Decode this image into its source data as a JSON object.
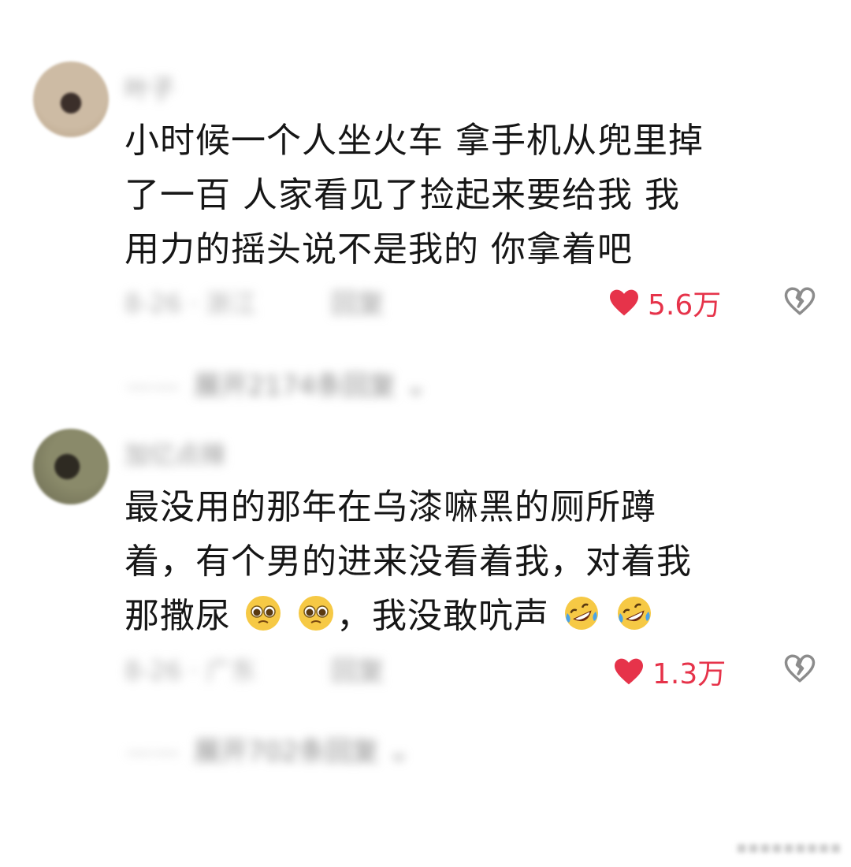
{
  "comments": [
    {
      "username": "叶子",
      "lines": [
        "小时候一个人坐火车  拿手机从兜里掉",
        "了一百 人家看见了捡起来要给我  我",
        "用力的摇头说不是我的 你拿着吧"
      ],
      "meta": "8-26 · 浙江",
      "reply_label": "回复",
      "likes": "5.6万",
      "expand_label": "展开2174条回复"
    },
    {
      "username": "加亿点辣",
      "lines": [
        "最没用的那年在乌漆嘛黑的厕所蹲",
        "着，有个男的进来没看着我，对着我"
      ],
      "line3_a": "那撒尿",
      "line3_b": "，我没敢吭声",
      "meta": "8-26 · 广东",
      "reply_label": "回复",
      "likes": "1.3万",
      "expand_label": "展开702条回复"
    }
  ],
  "icons": {
    "like": "heart-icon",
    "dislike": "broken-heart-icon",
    "emoji_pleading": "pleading-face-emoji",
    "emoji_laughing": "rolling-laughing-emoji",
    "expand": "chevron-down-icon"
  },
  "colors": {
    "like": "#e6334a",
    "muted": "#9a9a9a",
    "text": "#161616"
  }
}
